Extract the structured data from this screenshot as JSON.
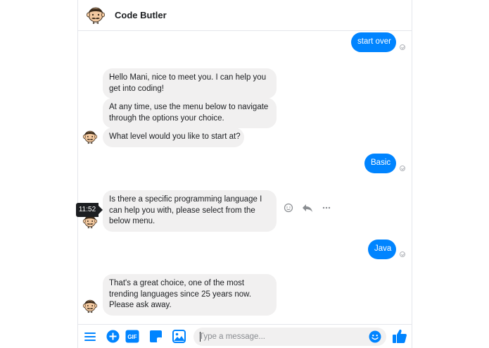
{
  "header": {
    "title": "Code Butler",
    "avatar_icon": "butler-avatar-icon"
  },
  "messages": [
    {
      "sender": "user",
      "text": "start over"
    },
    {
      "sender": "bot",
      "lines": [
        "Hello Mani, nice to meet you. I can help you",
        "get into coding!"
      ]
    },
    {
      "sender": "bot",
      "lines": [
        "At any time, use the menu below to navigate",
        "through the options your choice."
      ]
    },
    {
      "sender": "bot",
      "lines": [
        "What level would you like to start at?"
      ]
    },
    {
      "sender": "user",
      "text": "Basic"
    },
    {
      "sender": "bot",
      "lines": [
        "Is there a specific programming language I",
        "can help you with, please select from the",
        "below menu."
      ],
      "timestamp": "11:52"
    },
    {
      "sender": "user",
      "text": "Java"
    },
    {
      "sender": "bot",
      "lines": [
        "That's a great choice, one of the most",
        "trending languages since 25 years now.",
        "Please ask away."
      ]
    }
  ],
  "message_actions": [
    "smiley-icon",
    "reply-icon",
    "more-icon"
  ],
  "composer": {
    "placeholder": "Type a message...",
    "tools": [
      "menu-icon",
      "plus-icon",
      "gif-icon",
      "sticker-icon",
      "image-icon"
    ],
    "emoji_icon": "emoji-icon",
    "like_icon": "thumbs-up-icon"
  },
  "colors": {
    "accent": "#0084ff",
    "bot_bubble": "#f1f0f0",
    "text": "#1c1e21"
  }
}
